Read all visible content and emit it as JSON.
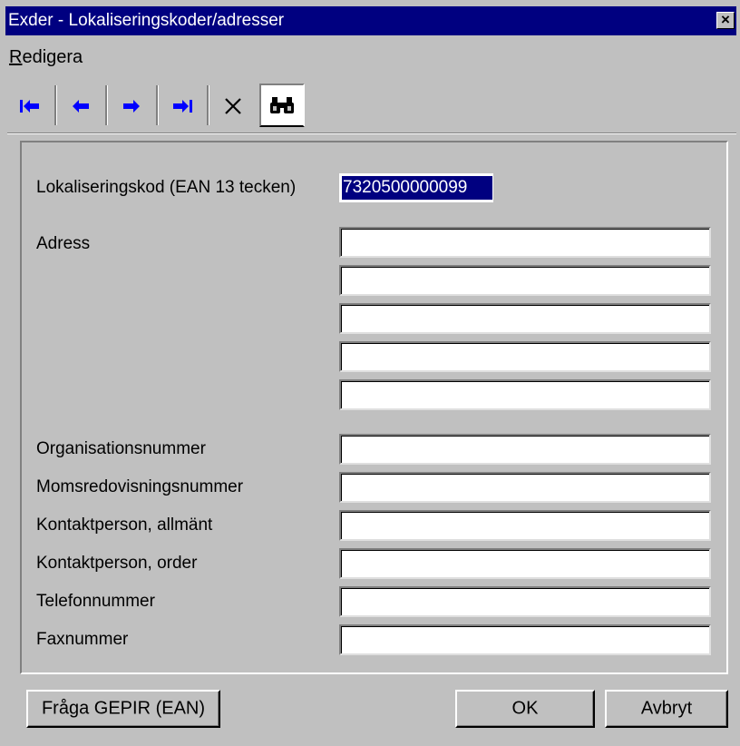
{
  "window": {
    "title": "Exder - Lokaliseringskoder/adresser",
    "close_glyph": "×"
  },
  "menu": {
    "items": [
      {
        "prefix": "R",
        "rest": "edigera",
        "label": "Redigera"
      }
    ]
  },
  "toolbar": {
    "buttons": [
      {
        "name": "first-record-button",
        "icon": "first-arrow-icon"
      },
      {
        "name": "previous-record-button",
        "icon": "left-arrow-icon"
      },
      {
        "name": "next-record-button",
        "icon": "right-arrow-icon"
      },
      {
        "name": "last-record-button",
        "icon": "last-arrow-icon"
      },
      {
        "name": "delete-button",
        "icon": "delete-x-icon"
      },
      {
        "name": "find-button",
        "icon": "binoculars-icon"
      }
    ],
    "arrow_color": "#0000ff"
  },
  "form": {
    "code_label": "Lokaliseringskod (EAN 13 tecken)",
    "code_value": "7320500000099",
    "address_label": "Adress",
    "address_lines": [
      "",
      "",
      "",
      "",
      ""
    ],
    "org_label": "Organisationsnummer",
    "org_value": "",
    "vat_label": "Momsredovisningsnummer",
    "vat_value": "",
    "contact_general_label": "Kontaktperson, allmänt",
    "contact_general_value": "",
    "contact_order_label": "Kontaktperson, order",
    "contact_order_value": "",
    "phone_label": "Telefonnummer",
    "phone_value": "",
    "fax_label": "Faxnummer",
    "fax_value": ""
  },
  "buttons": {
    "gepir": "Fråga GEPIR (EAN)",
    "ok": "OK",
    "cancel": "Avbryt"
  },
  "colors": {
    "titlebar": "#000080",
    "face": "#c0c0c0",
    "selection": "#000080"
  }
}
